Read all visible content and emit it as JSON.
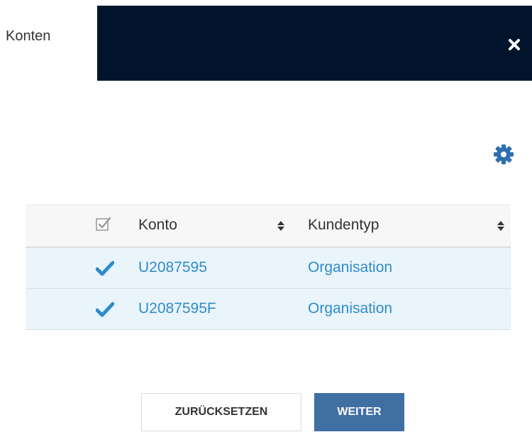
{
  "sidebar": {
    "label": "Konten"
  },
  "header": {
    "close_icon": "close-icon",
    "background": "#02142b"
  },
  "toolbar": {
    "settings_icon": "gear-icon",
    "icon_color": "#2f6fb0"
  },
  "table": {
    "columns": [
      {
        "label": "Konto"
      },
      {
        "label": "Kundentyp"
      }
    ],
    "rows": [
      {
        "konto": "U2087595",
        "kundentyp": "Organisation",
        "selected": true
      },
      {
        "konto": "U2087595F",
        "kundentyp": "Organisation",
        "selected": true
      }
    ],
    "row_background": "#eaf4fb",
    "link_color": "#2f8ccb"
  },
  "actions": {
    "reset_label": "ZURÜCKSETZEN",
    "next_label": "WEITER",
    "next_color": "#3f6fa3"
  }
}
